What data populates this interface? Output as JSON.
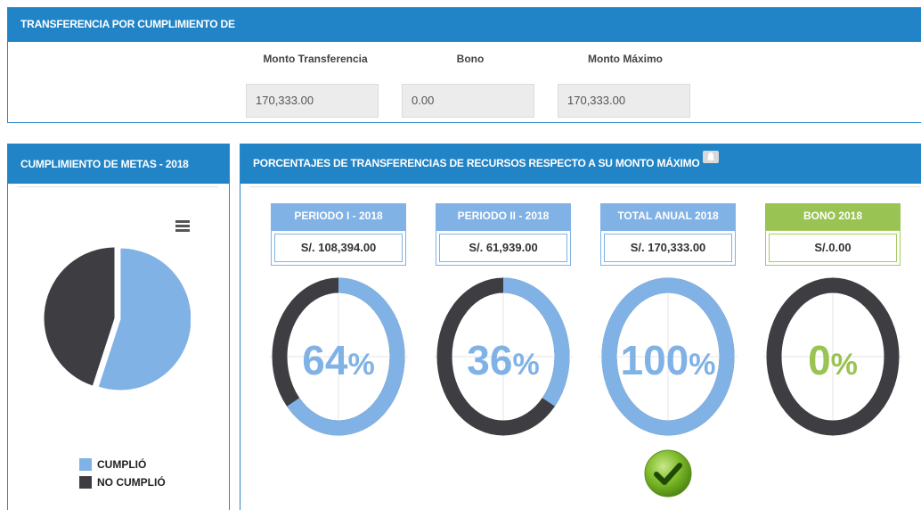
{
  "colors": {
    "header_blue": "#2184c6",
    "light_blue": "#80b2e6",
    "dark_gray": "#3d3d42",
    "green": "#99c352",
    "field_bg": "#ececec"
  },
  "transfer": {
    "title": "TRANSFERENCIA POR CUMPLIMIENTO DE",
    "labels": {
      "monto_transferencia": "Monto Transferencia",
      "bono": "Bono",
      "monto_maximo": "Monto Máximo"
    },
    "values": {
      "monto_transferencia": "170,333.00",
      "bono": "0.00",
      "monto_maximo": "170,333.00"
    }
  },
  "metas": {
    "title": "CUMPLIMIENTO DE METAS - 2018",
    "menu_icon": "hamburger-icon",
    "pie": [
      {
        "label": "CUMPLIÓ",
        "value": 55,
        "color": "#80b2e6"
      },
      {
        "label": "NO CUMPLIÓ",
        "value": 45,
        "color": "#3d3d42"
      }
    ],
    "legend": {
      "cumplio": "CUMPLIÓ",
      "no_cumplio": "NO CUMPLIÓ"
    }
  },
  "porcentajes": {
    "title": "PORCENTAJES DE TRANSFERENCIAS DE RECURSOS RESPECTO A SU MONTO MÁXIMO",
    "title_icon": "bell-icon",
    "cards": [
      {
        "header": "PERIODO I - 2018",
        "amount": "S/. 108,394.00",
        "percent": 64,
        "percent_text": "64",
        "color": "#80b2e6"
      },
      {
        "header": "PERIODO II - 2018",
        "amount": "S/. 61,939.00",
        "percent": 36,
        "percent_text": "36",
        "color": "#80b2e6"
      },
      {
        "header": "TOTAL ANUAL 2018",
        "amount": "S/. 170,333.00",
        "percent": 100,
        "percent_text": "100",
        "color": "#80b2e6"
      },
      {
        "header": "BONO 2018",
        "amount": "S/.0.00",
        "percent": 0,
        "percent_text": "0",
        "color": "#99c352"
      }
    ],
    "percent_sign": "%",
    "check_icon": "check-icon"
  }
}
